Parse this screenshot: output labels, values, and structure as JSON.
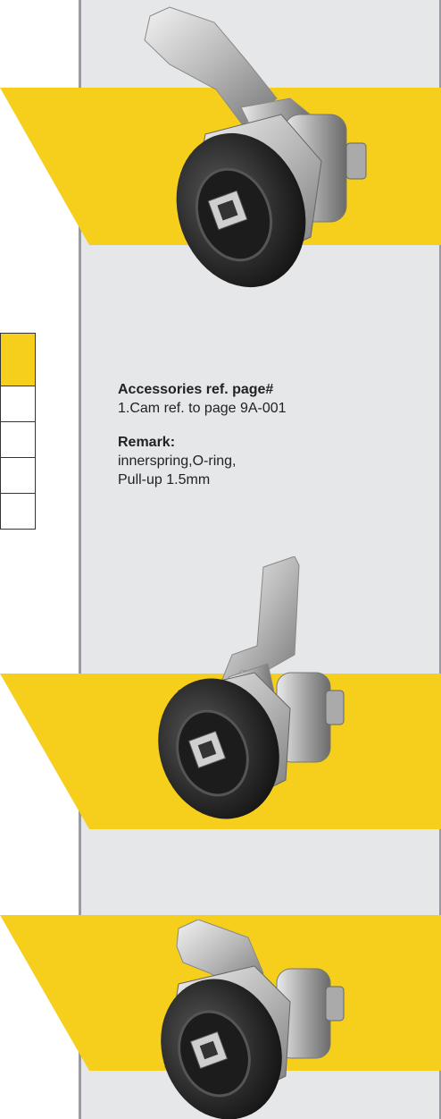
{
  "colors": {
    "accent_yellow": "#f5cf1b",
    "panel_gray": "#e6e7e8",
    "divider_gray": "#9a9ba0"
  },
  "notes": {
    "accessories_heading": "Accessories ref. page#",
    "accessories_item": "1.Cam ref. to page 9A-001",
    "remark_heading": "Remark:",
    "remark_line1": "innerspring,O-ring,",
    "remark_line2": "Pull-up 1.5mm"
  },
  "products": [
    {
      "icon": "cam-lock-with-bent-lever-icon"
    },
    {
      "icon": "cam-lock-with-z-lever-icon"
    },
    {
      "icon": "cam-lock-with-short-lever-icon"
    }
  ]
}
